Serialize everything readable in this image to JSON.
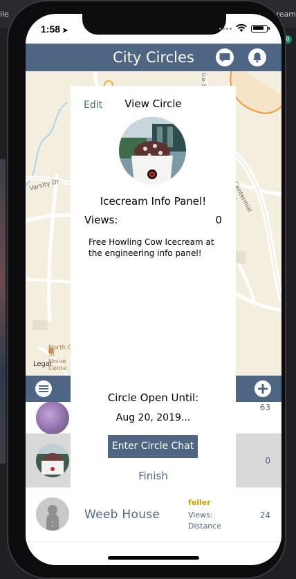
{
  "background_window": {
    "left_fragment": "ile",
    "right_fragment": "ream",
    "badge": "0"
  },
  "status_bar": {
    "time": "1:58",
    "location_arrow": "➤",
    "battery_level": 0.85
  },
  "header": {
    "title": "City Circles",
    "chat_icon": "chat-bubble-icon",
    "bell_icon": "bell-icon"
  },
  "map": {
    "labels": {
      "street_varsity": "Varsity Dr",
      "street_centennial": "Centennial Pkwy",
      "street_vert": "ice S",
      "campus": "North C\nSt\nUnive\nCente",
      "legal": "Legal"
    }
  },
  "panel": {
    "edit_label": "Edit",
    "heading": "View Circle",
    "circle_name": "Icecream Info Panel!",
    "views_label": "Views:",
    "views_value": "0",
    "description": "Free Howling Cow Icecream at the engineering info panel!",
    "open_until_label": "Circle Open Until:",
    "open_until_date": "Aug 20, 2019...",
    "chat_button_label": "Enter Circle Chat",
    "finish_label": "Finish"
  },
  "list_bar": {
    "menu_icon": "menu-icon",
    "add_icon": "plus-icon"
  },
  "rows": [
    {
      "count": "63"
    },
    {
      "count": "0"
    },
    {
      "name": "Weeb House",
      "owner": "feller",
      "views_label": "Views:",
      "distance_label": "Distance",
      "count": "24"
    }
  ],
  "colors": {
    "accent": "#4e6683",
    "owner_gold": "#c9a200",
    "map_bg": "#f3eedd"
  }
}
